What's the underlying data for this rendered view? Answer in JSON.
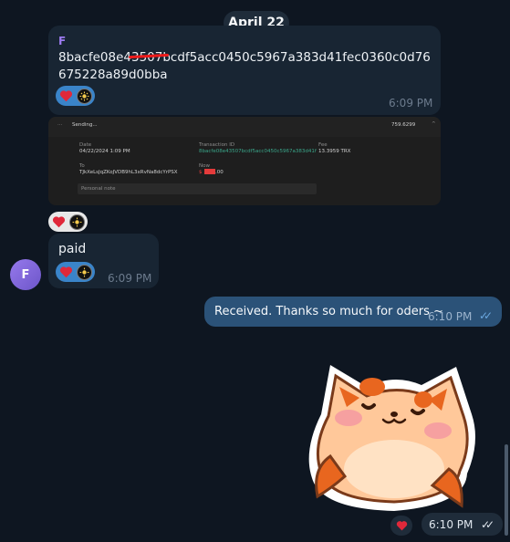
{
  "chat": {
    "date_label": "April 22",
    "messages": [
      {
        "sender_initial": "F",
        "text": "8bacfe08e43507bcdf5acc0450c5967a383d41fec0360c0d76675228a89d0bba",
        "time": "6:09 PM"
      },
      {
        "screenshot": {
          "title": "Sending...",
          "amount": "759.6299",
          "date_label": "Date",
          "date_value": "04/22/2024 1:09 PM",
          "txid_label": "Transaction ID",
          "txid_value": "8bacfe08e43507bcdf5acc0450c5967a383d41f",
          "fee_label": "Fee",
          "fee_value": "13.3959 TRX",
          "to_label": "To",
          "to_value": "TJkXeLsJqZKoJVDB9hL3xRvNa8dcYrPSX",
          "now_label": "Now",
          "now_value": "$",
          "now_suffix": ".00",
          "note_placeholder": "Personal note"
        }
      },
      {
        "text": "paid",
        "time": "6:09 PM",
        "avatar_initial": "F"
      },
      {
        "text": "Received. Thanks so much for oders ~",
        "time": "6:10 PM",
        "outgoing": true
      },
      {
        "sticker": "fox-sticker",
        "time": "6:10 PM",
        "outgoing": true
      }
    ]
  },
  "icons": {
    "reaction_heart": "heart-icon",
    "reaction_avatar": "reactor-avatar-icon",
    "read_checks": "double-check-icon"
  },
  "colors": {
    "background": "#0e1621",
    "incoming_bubble": "#182533",
    "outgoing_bubble": "#2b5278",
    "sender_name": "#9d7bf0",
    "reaction_active": "#3a84c9",
    "heart": "#e0283a"
  }
}
